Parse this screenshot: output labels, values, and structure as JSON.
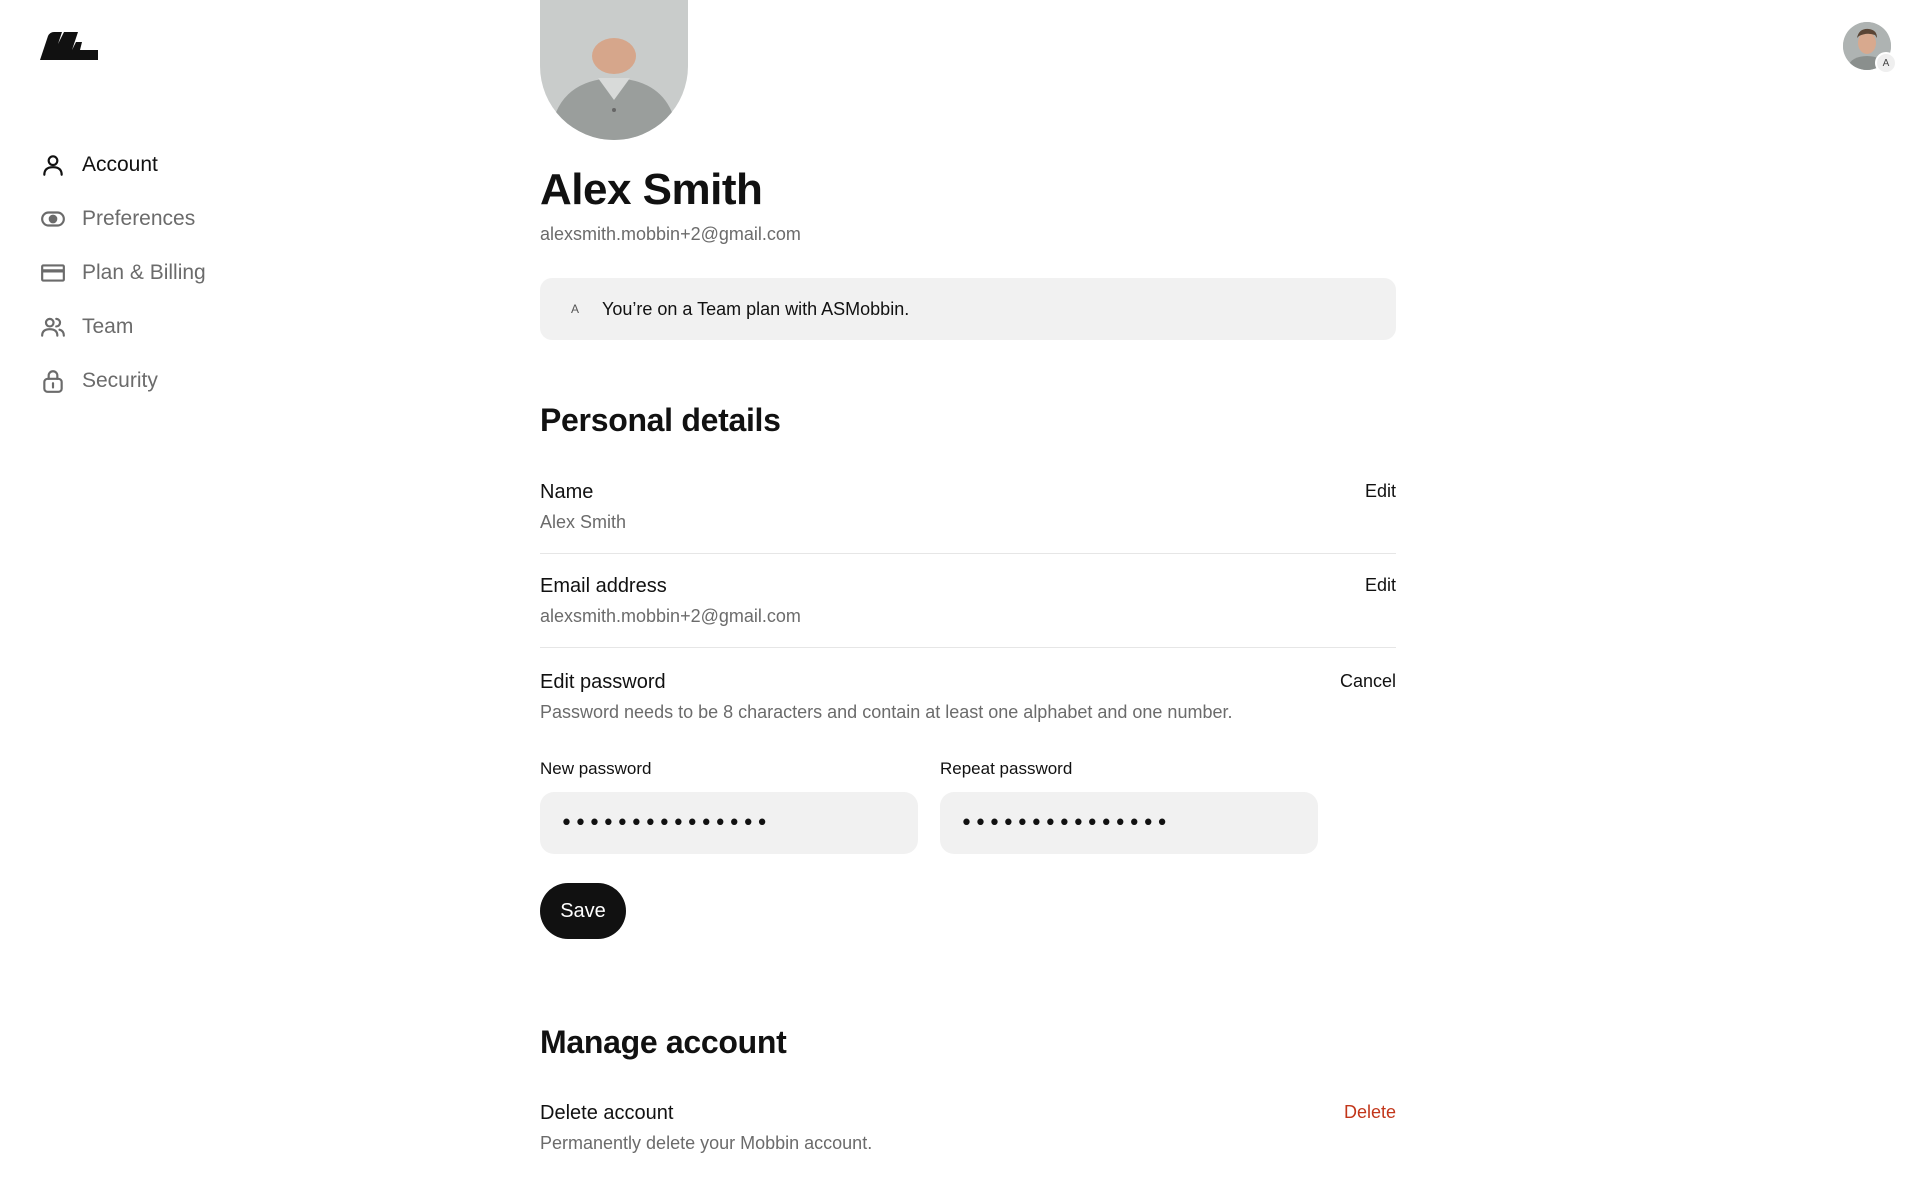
{
  "logo": {
    "icon": "mobbin-logo-icon"
  },
  "sidebar": {
    "items": [
      {
        "label": "Account",
        "icon": "user-icon",
        "active": true
      },
      {
        "label": "Preferences",
        "icon": "eye-icon",
        "active": false
      },
      {
        "label": "Plan & Billing",
        "icon": "credit-card-icon",
        "active": false
      },
      {
        "label": "Team",
        "icon": "users-icon",
        "active": false
      },
      {
        "label": "Security",
        "icon": "lock-icon",
        "active": false
      }
    ]
  },
  "header": {
    "avatar_badge": "A"
  },
  "profile": {
    "name": "Alex Smith",
    "email": "alexsmith.mobbin+2@gmail.com"
  },
  "plan_banner": {
    "badge": "A",
    "text": "You’re on a Team plan with ASMobbin."
  },
  "personal_details": {
    "title": "Personal details",
    "name_row": {
      "label": "Name",
      "value": "Alex Smith",
      "action": "Edit"
    },
    "email_row": {
      "label": "Email address",
      "value": "alexsmith.mobbin+2@gmail.com",
      "action": "Edit"
    },
    "password_row": {
      "label": "Edit password",
      "hint": "Password needs to be 8 characters and contain at least one alphabet and one number.",
      "action": "Cancel",
      "new_password_label": "New password",
      "new_password_value": "•••••••••••••••",
      "repeat_password_label": "Repeat password",
      "repeat_password_value": "•••••••••••••••",
      "save_label": "Save"
    }
  },
  "manage_account": {
    "title": "Manage account",
    "delete_row": {
      "label": "Delete account",
      "value": "Permanently delete your Mobbin account.",
      "action": "Delete"
    }
  },
  "colors": {
    "text": "#111111",
    "muted": "#6b6b6b",
    "field_bg": "#f1f1f1",
    "danger": "#c2361a",
    "button_bg": "#111111"
  }
}
